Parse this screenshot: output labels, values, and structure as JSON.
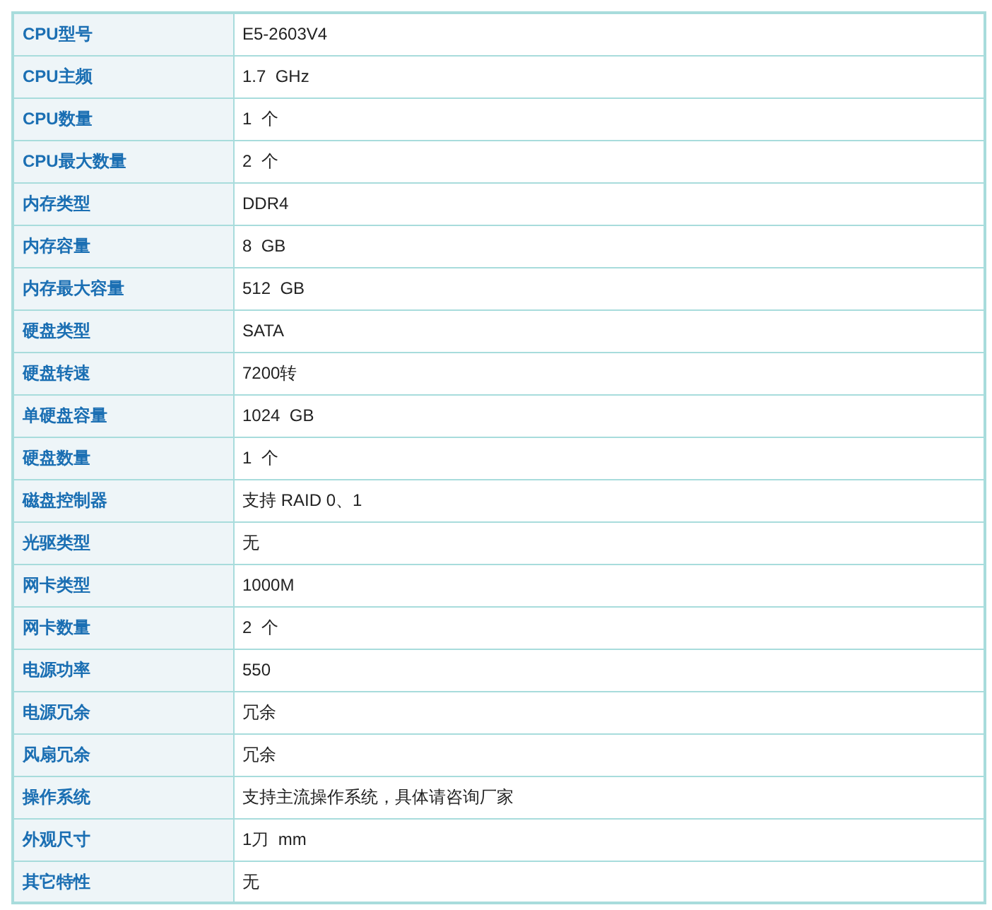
{
  "specs": [
    {
      "label": "CPU型号",
      "value": "E5-2603V4"
    },
    {
      "label": "CPU主频",
      "value": "1.7  GHz"
    },
    {
      "label": "CPU数量",
      "value": "1  个"
    },
    {
      "label": "CPU最大数量",
      "value": "2  个"
    },
    {
      "label": "内存类型",
      "value": "DDR4"
    },
    {
      "label": "内存容量",
      "value": "8  GB"
    },
    {
      "label": "内存最大容量",
      "value": "512  GB"
    },
    {
      "label": "硬盘类型",
      "value": "SATA"
    },
    {
      "label": "硬盘转速",
      "value": "7200转"
    },
    {
      "label": "单硬盘容量",
      "value": "1024  GB"
    },
    {
      "label": "硬盘数量",
      "value": "1  个"
    },
    {
      "label": "磁盘控制器",
      "value": "支持 RAID 0、1"
    },
    {
      "label": "光驱类型",
      "value": "无"
    },
    {
      "label": "网卡类型",
      "value": "1000M"
    },
    {
      "label": "网卡数量",
      "value": "2  个"
    },
    {
      "label": "电源功率",
      "value": "550"
    },
    {
      "label": "电源冗余",
      "value": "冗余"
    },
    {
      "label": "风扇冗余",
      "value": "冗余"
    },
    {
      "label": "操作系统",
      "value": "支持主流操作系统，具体请咨询厂家"
    },
    {
      "label": "外观尺寸",
      "value": "1刀  mm"
    },
    {
      "label": "其它特性",
      "value": "无"
    }
  ]
}
